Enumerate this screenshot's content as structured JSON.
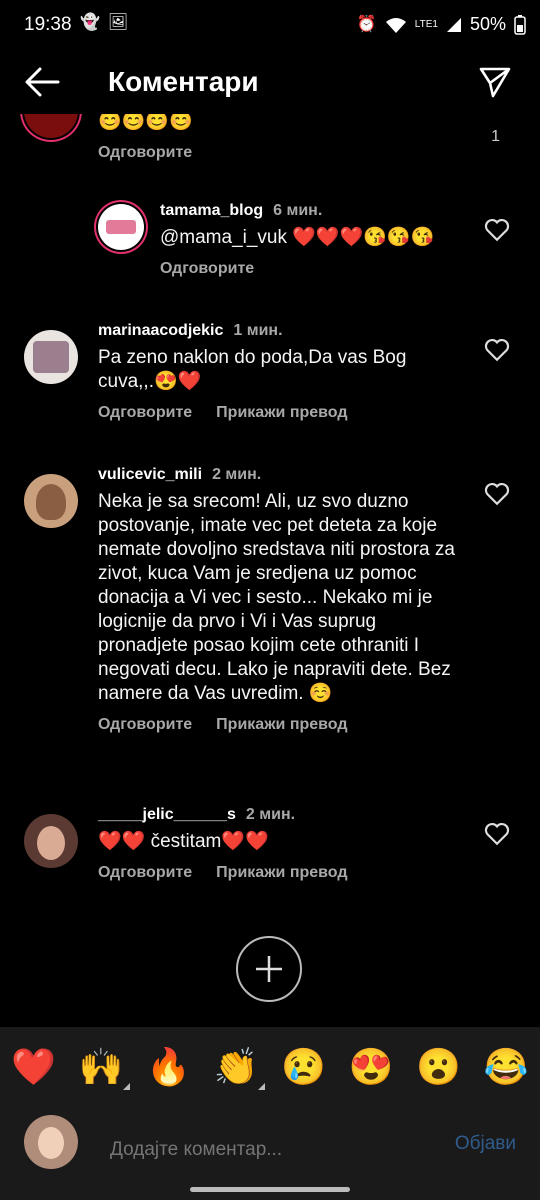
{
  "status": {
    "time": "19:38",
    "battery": "50%",
    "network": "LTE1"
  },
  "header": {
    "title": "Коментари"
  },
  "comments": [
    {
      "username": "",
      "time": "",
      "text": "😊😊😊😊",
      "reply": "Одговорите",
      "likes": "1"
    },
    {
      "username": "tamama_blog",
      "time": "6 мин.",
      "text": "@mama_i_vuk ❤️❤️❤️😘😘😘",
      "reply": "Одговорите"
    },
    {
      "username": "marinaacodjekic",
      "time": "1 мин.",
      "text": "Pa zeno naklon do poda,Da vas Bog cuva,,.😍❤️",
      "reply": "Одговорите",
      "translate": "Прикажи превод"
    },
    {
      "username": "vulicevic_mili",
      "time": "2 мин.",
      "text": "Neka je sa srecom! Ali, uz svo duzno postovanje, imate vec pet deteta za koje nemate dovoljno sredstava niti prostora za zivot, kuca Vam je sredjena uz pomoc donacija a Vi vec i sesto... Nekako mi je logicnije da prvo i Vi i Vas suprug pronadjete posao kojim cete othraniti I negovati decu. Lako je napraviti dete. Bez namere da Vas uvredim. ☺️",
      "reply": "Одговорите",
      "translate": "Прикажи превод"
    },
    {
      "username": "_____jelic______s",
      "time": "2 мин.",
      "text": "❤️❤️ čestitam❤️❤️",
      "reply": "Одговорите",
      "translate": "Прикажи превод"
    }
  ],
  "reactions": [
    "❤️",
    "🙌",
    "🔥",
    "👏",
    "😢",
    "😍",
    "😮",
    "😂"
  ],
  "composer": {
    "placeholder": "Додајте коментар...",
    "post": "Објави"
  }
}
